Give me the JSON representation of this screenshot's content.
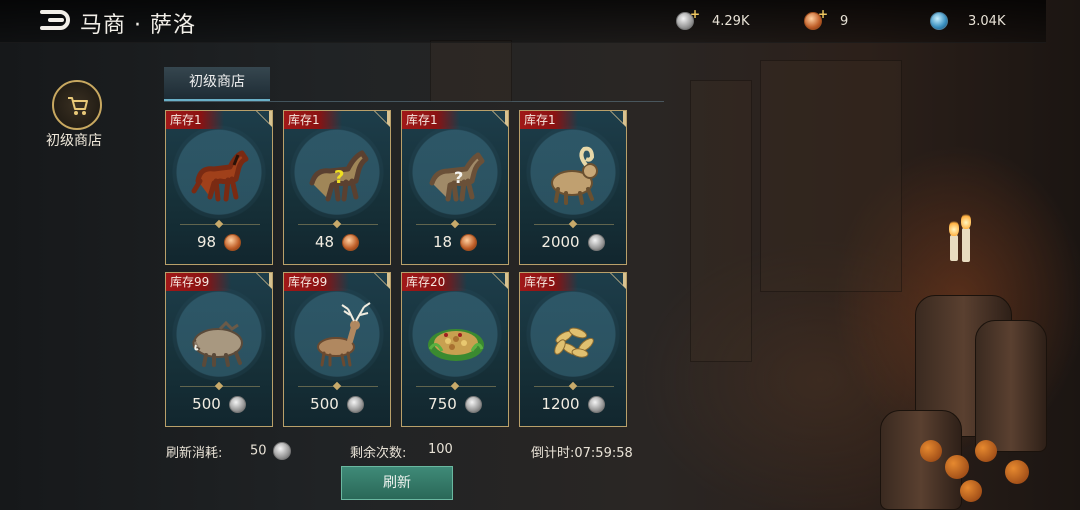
{
  "header": {
    "title": "马商 · 萨洛",
    "resources": [
      {
        "name": "silver-coin",
        "value": "4.29K",
        "has_plus": true
      },
      {
        "name": "copper-coin",
        "value": "9",
        "has_plus": true
      },
      {
        "name": "gem",
        "value": "3.04K",
        "has_plus": false
      }
    ]
  },
  "sidebar": {
    "shop_label": "初级商店"
  },
  "tab": {
    "label": "初级商店"
  },
  "items": [
    {
      "stock": "库存1",
      "price": "98",
      "currency": "copper",
      "art": "horse-brown"
    },
    {
      "stock": "库存1",
      "price": "48",
      "currency": "copper",
      "art": "horse-mystery"
    },
    {
      "stock": "库存1",
      "price": "18",
      "currency": "copper",
      "art": "horse-mystery-small"
    },
    {
      "stock": "库存1",
      "price": "2000",
      "currency": "silver",
      "art": "ram"
    },
    {
      "stock": "库存99",
      "price": "500",
      "currency": "silver",
      "art": "boar"
    },
    {
      "stock": "库存99",
      "price": "500",
      "currency": "silver",
      "art": "deer"
    },
    {
      "stock": "库存20",
      "price": "750",
      "currency": "silver",
      "art": "salad"
    },
    {
      "stock": "库存5",
      "price": "1200",
      "currency": "silver",
      "art": "grain"
    }
  ],
  "footer": {
    "refresh_cost_label": "刷新消耗:",
    "refresh_cost_value": "50",
    "remaining_label": "剩余次数:",
    "remaining_value": "100",
    "countdown": "倒计时:07:59:58",
    "refresh_button": "刷新"
  },
  "colors": {
    "accent_gold": "#c8a860",
    "button_green": "#3f8a78",
    "stock_red": "#a01818"
  }
}
